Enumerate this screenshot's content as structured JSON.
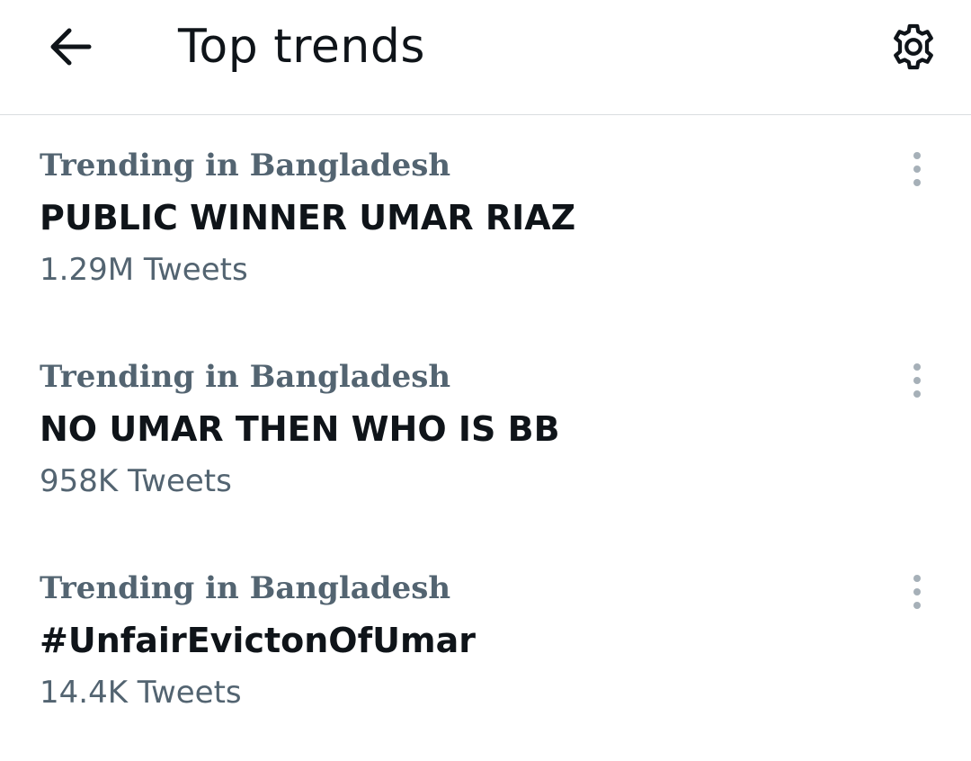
{
  "header": {
    "title": "Top trends",
    "back_icon": "arrow-left-icon",
    "settings_icon": "gear-icon"
  },
  "trends": [
    {
      "context": "Trending in Bangladesh",
      "name": "PUBLIC WINNER UMAR RIAZ",
      "count": "1.29M Tweets"
    },
    {
      "context": "Trending in Bangladesh",
      "name": "NO UMAR THEN WHO IS BB",
      "count": "958K Tweets"
    },
    {
      "context": "Trending in Bangladesh",
      "name": "#UnfairEvictonOfUmar",
      "count": "14.4K Tweets"
    }
  ],
  "colors": {
    "primary_text": "#0f1419",
    "secondary_text": "#536471",
    "divider": "#d9dde0",
    "more_icon": "#a6b0b8"
  }
}
